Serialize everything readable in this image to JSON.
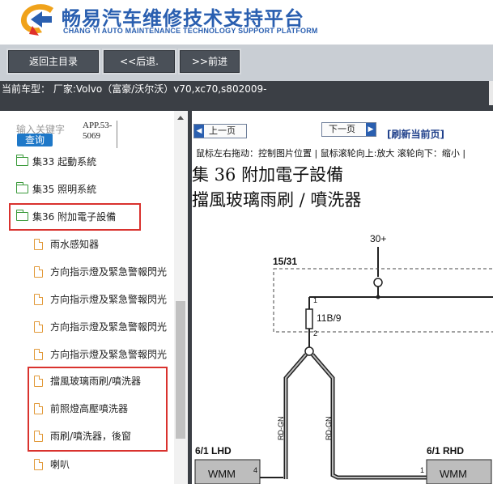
{
  "header": {
    "title_cn": "畅易汽车维修技术支持平台",
    "title_en": "CHANG YI AUTO MAINTENANCE TECHNOLOGY SUPPORT PLATFORM"
  },
  "toolbar": {
    "home_label": "返回主目录",
    "back_label": "<<后退.",
    "forward_label": ">>前进"
  },
  "model_bar": {
    "text": "当前车型： 厂家:Volvo（富豪/沃尔沃）v70,xc70,s802009-"
  },
  "sidebar": {
    "search_label": "输入关键字",
    "search_button": "查询",
    "search_value": "APP.53-5069",
    "items": [
      {
        "label": "集33 起動系統",
        "type": "folder"
      },
      {
        "label": "集35 照明系統",
        "type": "folder"
      },
      {
        "label": "集36 附加電子設備",
        "type": "folder-open"
      },
      {
        "label": "雨水感知器",
        "type": "file"
      },
      {
        "label": "方向指示燈及緊急警報閃光",
        "type": "file"
      },
      {
        "label": "方向指示燈及緊急警報閃光",
        "type": "file"
      },
      {
        "label": "方向指示燈及緊急警報閃光",
        "type": "file"
      },
      {
        "label": "方向指示燈及緊急警報閃光",
        "type": "file"
      },
      {
        "label": "擋風玻璃雨刷/噴洗器",
        "type": "file"
      },
      {
        "label": "前照燈高壓噴洗器",
        "type": "file"
      },
      {
        "label": "雨刷/噴洗器，後窗",
        "type": "file"
      },
      {
        "label": "喇叭",
        "type": "file"
      }
    ]
  },
  "viewer": {
    "prev_label": "上一页",
    "next_label": "下一页",
    "refresh_label": "[刷新当前页]",
    "hint": "鼠标左右拖动：控制图片位置 | 鼠标滚轮向上:放大  滚轮向下：缩小 |",
    "doc_title_line1": "集 36 附加電子設備",
    "doc_title_line2": "擋風玻璃雨刷 / 噴洗器",
    "diagram": {
      "supply_label": "30+",
      "fuse_box_label": "15/31",
      "fuse_label": "11B/9",
      "pin1": "1",
      "pin2": "2",
      "wire_left": "RD-GN",
      "wire_right": "RD-GN",
      "left_unit_label": "6/1 LHD",
      "right_unit_label": "6/1 RHD",
      "left_module": "WMM",
      "right_module": "WMM",
      "left_pin": "4",
      "right_pin": "1"
    }
  }
}
